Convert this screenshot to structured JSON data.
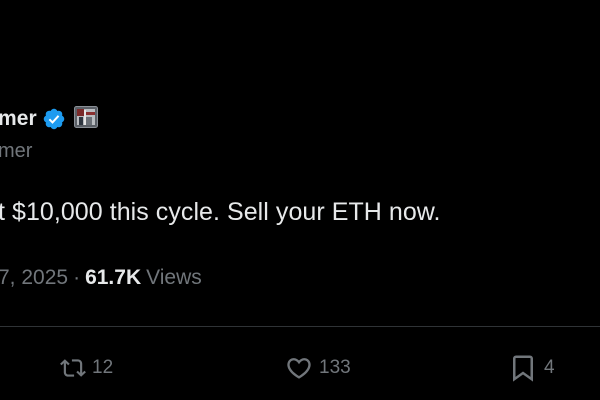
{
  "tweet": {
    "display_name": "mer",
    "handle": "mer",
    "text": "t $10,000 this cycle. Sell your ETH now.",
    "date": "7, 2025",
    "separator": "·",
    "views_count": "61.7K",
    "views_label": "Views"
  },
  "actions": {
    "retweets": "12",
    "likes": "133",
    "bookmarks": "4"
  },
  "icons": {
    "verified": "verified-badge-icon",
    "flag": "flag-emoji-icon",
    "retweet": "retweet-icon",
    "like": "heart-icon",
    "bookmark": "bookmark-icon"
  },
  "colors": {
    "background": "#000000",
    "primary_text": "#e7e9ea",
    "secondary_text": "#71767b",
    "verified_blue": "#1d9bf0",
    "divider": "#2f3336"
  }
}
